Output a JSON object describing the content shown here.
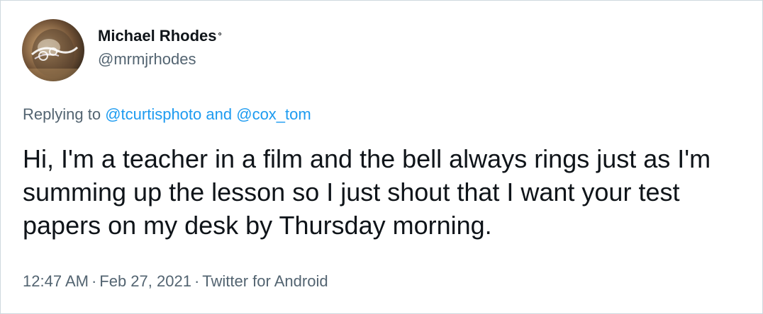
{
  "author": {
    "display_name": "Michael Rhodes",
    "name_mark": "°",
    "handle": "@mrmjrhodes"
  },
  "reply_context": {
    "prefix": "Replying to",
    "mention_1": "@tcurtisphoto",
    "conjunction": "and",
    "mention_2": "@cox_tom"
  },
  "tweet": {
    "text": "Hi, I'm a teacher in a film and the bell always rings just as I'm summing up the lesson so I just shout that I want your test papers on my desk by Thursday morning."
  },
  "meta": {
    "time": "12:47 AM",
    "separator": "·",
    "date": "Feb 27, 2021",
    "source": "Twitter for Android"
  },
  "colors": {
    "text_primary": "#0f1419",
    "text_secondary": "#536471",
    "link": "#1d9bf0",
    "border": "#cfd9de"
  }
}
